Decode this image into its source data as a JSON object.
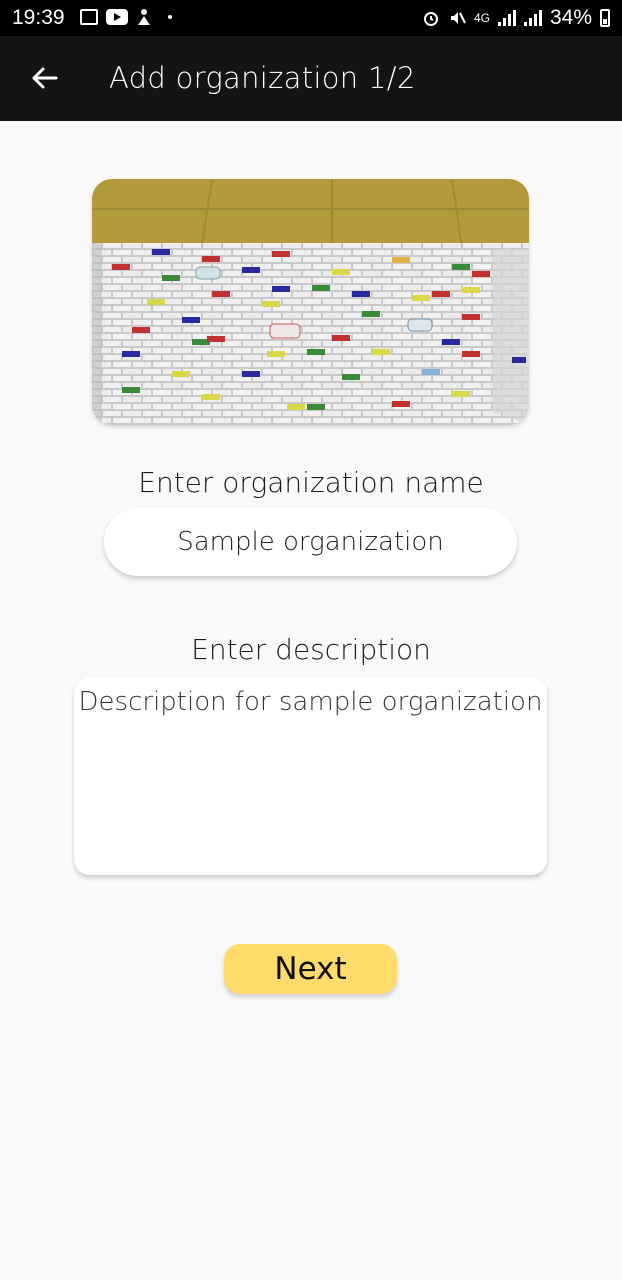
{
  "status_bar": {
    "time": "19:39",
    "network": "4G",
    "battery": "34%",
    "icons": [
      "image-icon",
      "youtube-icon",
      "app-icon",
      "alarm-icon",
      "mute-icon",
      "signal-icon",
      "battery-icon"
    ]
  },
  "app_bar": {
    "back_icon": "arrow-left-icon",
    "title": "Add organization 1/2"
  },
  "form": {
    "name_label": "Enter organization name",
    "name_value": "Sample organization",
    "description_label": "Enter description",
    "description_value": "Description for sample organization",
    "next_label": "Next"
  },
  "colors": {
    "app_bar": "#141414",
    "background": "#f9f9f9",
    "button": "#fedb6b"
  }
}
